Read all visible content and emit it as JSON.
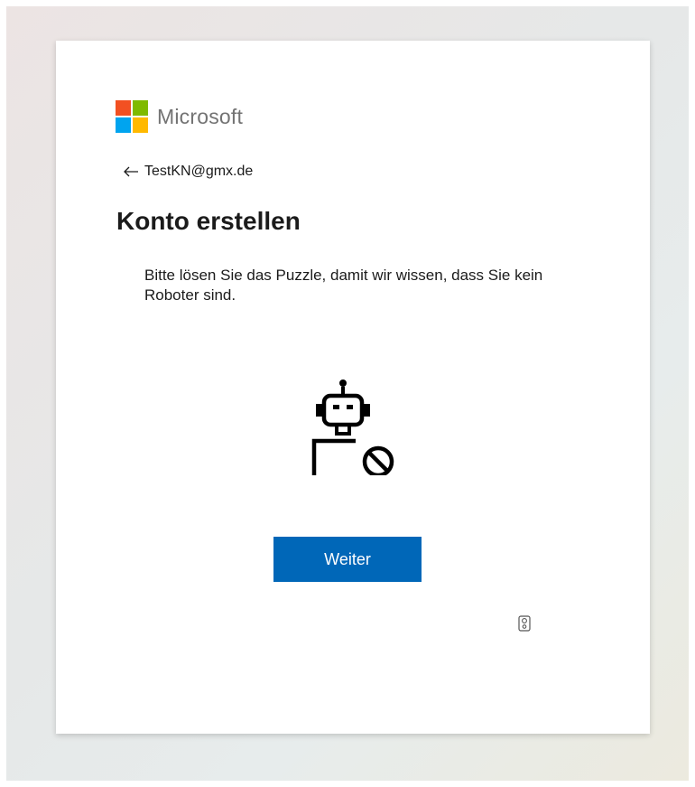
{
  "brand": {
    "name": "Microsoft",
    "logo_colors": [
      "#f25022",
      "#7fba00",
      "#00a4ef",
      "#ffb900"
    ]
  },
  "identity": {
    "email": "TestKN@gmx.de"
  },
  "page": {
    "title": "Konto erstellen",
    "description": "Bitte lösen Sie das Puzzle, damit wir wissen, dass Sie kein Roboter sind."
  },
  "actions": {
    "continue_label": "Weiter"
  },
  "icons": {
    "back": "arrow-left-icon",
    "challenge": "robot-blocked-icon",
    "audio": "audio-challenge-icon"
  },
  "colors": {
    "accent": "#0067b8",
    "text": "#1b1b1b",
    "logo_text": "#737373"
  }
}
